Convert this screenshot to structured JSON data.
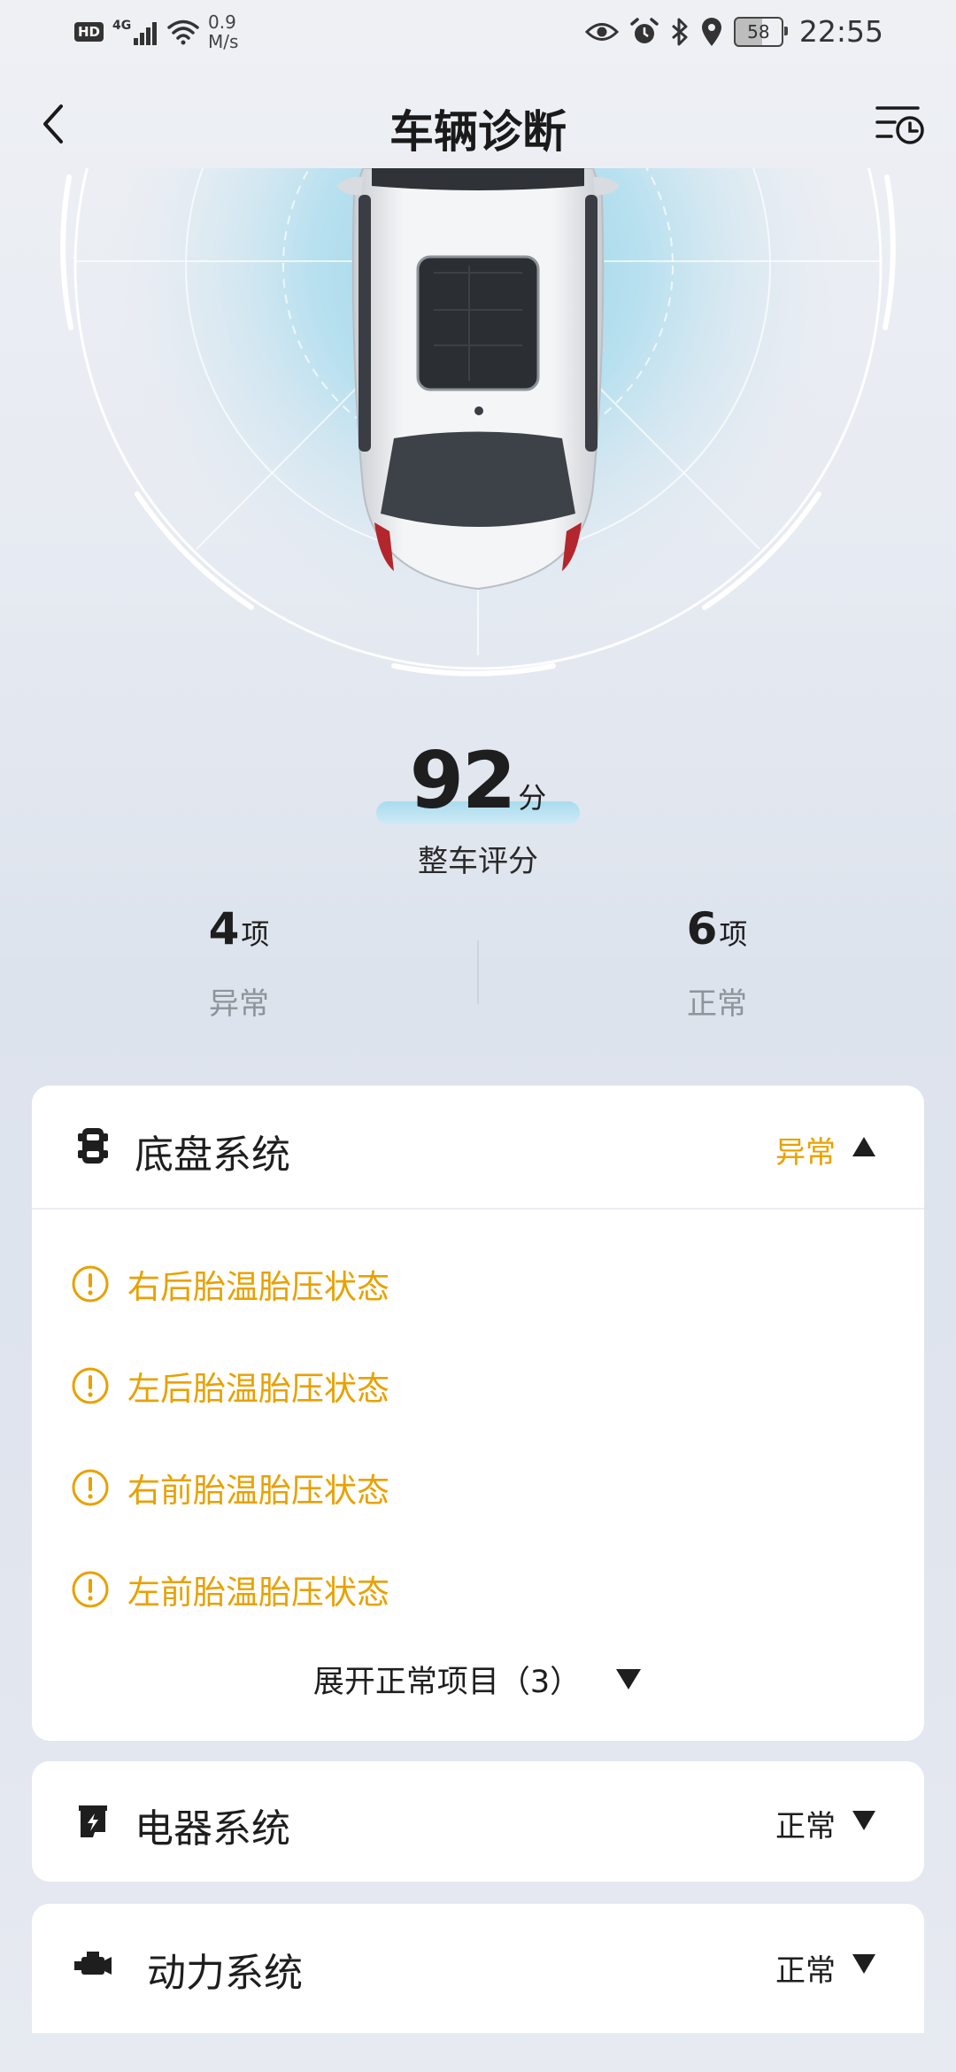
{
  "status_bar": {
    "hd": "HD",
    "network": "4G",
    "speed_value": "0.9",
    "speed_unit": "M/s",
    "battery": "58",
    "time": "22:55",
    "icons": [
      "eye-icon",
      "alarm-icon",
      "bluetooth-icon",
      "location-icon"
    ]
  },
  "header": {
    "title": "车辆诊断",
    "back_icon": "chevron-left-icon",
    "history_icon": "history-list-icon"
  },
  "score": {
    "value": "92",
    "unit": "分",
    "label": "整车评分"
  },
  "stats": {
    "abnormal": {
      "count": "4",
      "unit": "项",
      "label": "异常"
    },
    "normal": {
      "count": "6",
      "unit": "项",
      "label": "正常"
    }
  },
  "systems": [
    {
      "name": "底盘系统",
      "icon": "chassis-icon",
      "status": "异常",
      "expanded": true,
      "issues": [
        "右后胎温胎压状态",
        "左后胎温胎压状态",
        "右前胎温胎压状态",
        "左前胎温胎压状态"
      ],
      "expand_label": "展开正常项目（3）"
    },
    {
      "name": "电器系统",
      "icon": "electrical-icon",
      "status": "正常",
      "expanded": false
    },
    {
      "name": "动力系统",
      "icon": "engine-icon",
      "status": "正常",
      "expanded": false
    }
  ],
  "colors": {
    "warning": "#e8a100",
    "text": "#1e1e1e",
    "muted": "#8f939a",
    "radar_glow": "#a9dbee"
  }
}
